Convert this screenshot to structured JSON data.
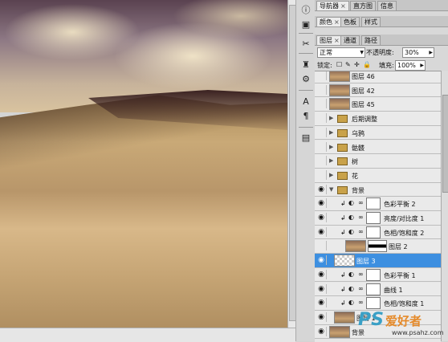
{
  "canvas": {
    "image": "desert-dune-photo"
  },
  "panel": {
    "top_tabs": [
      {
        "label": "导航器",
        "active": true
      },
      {
        "label": "直方图",
        "active": false
      },
      {
        "label": "信息",
        "active": false
      }
    ],
    "color_tabs": [
      {
        "label": "颜色",
        "active": true
      },
      {
        "label": "色板",
        "active": false
      },
      {
        "label": "样式",
        "active": false
      }
    ],
    "layer_tabs": [
      {
        "label": "图层",
        "active": true
      },
      {
        "label": "通道",
        "active": false
      },
      {
        "label": "路径",
        "active": false
      }
    ],
    "blend_mode": "正常",
    "opacity_label": "不透明度:",
    "opacity_value": "30%",
    "lock_label": "锁定:",
    "fill_label": "填充:",
    "fill_value": "100%"
  },
  "layers": [
    {
      "name": "图层 46",
      "kind": "image",
      "visible": false
    },
    {
      "name": "图层 42",
      "kind": "image",
      "visible": false
    },
    {
      "name": "图层 45",
      "kind": "image",
      "visible": false
    },
    {
      "name": "后期调整",
      "kind": "group",
      "visible": false,
      "expanded": false
    },
    {
      "name": "乌鸦",
      "kind": "group",
      "visible": false,
      "expanded": false
    },
    {
      "name": "骷髅",
      "kind": "group",
      "visible": false,
      "expanded": false
    },
    {
      "name": "树",
      "kind": "group",
      "visible": false,
      "expanded": false
    },
    {
      "name": "花",
      "kind": "group",
      "visible": false,
      "expanded": false
    },
    {
      "name": "背景",
      "kind": "group",
      "visible": true,
      "expanded": true
    },
    {
      "name": "色彩平衡 2",
      "kind": "adjust",
      "visible": true
    },
    {
      "name": "亮度/对比度 1",
      "kind": "adjust",
      "visible": true
    },
    {
      "name": "色相/饱和度 2",
      "kind": "adjust",
      "visible": true
    },
    {
      "name": "图层 2",
      "kind": "image-mask",
      "visible": false
    },
    {
      "name": "图层 3",
      "kind": "image",
      "visible": true,
      "selected": true
    },
    {
      "name": "色彩平衡 1",
      "kind": "adjust",
      "visible": true
    },
    {
      "name": "曲线 1",
      "kind": "adjust",
      "visible": true
    },
    {
      "name": "色相/饱和度 1",
      "kind": "adjust",
      "visible": true
    },
    {
      "name": "图层 1",
      "kind": "image",
      "visible": true
    },
    {
      "name": "背景",
      "kind": "image",
      "visible": true
    }
  ],
  "watermark": {
    "ps": "PS",
    "cn": "爱好者",
    "url": "www.psahz.com"
  }
}
